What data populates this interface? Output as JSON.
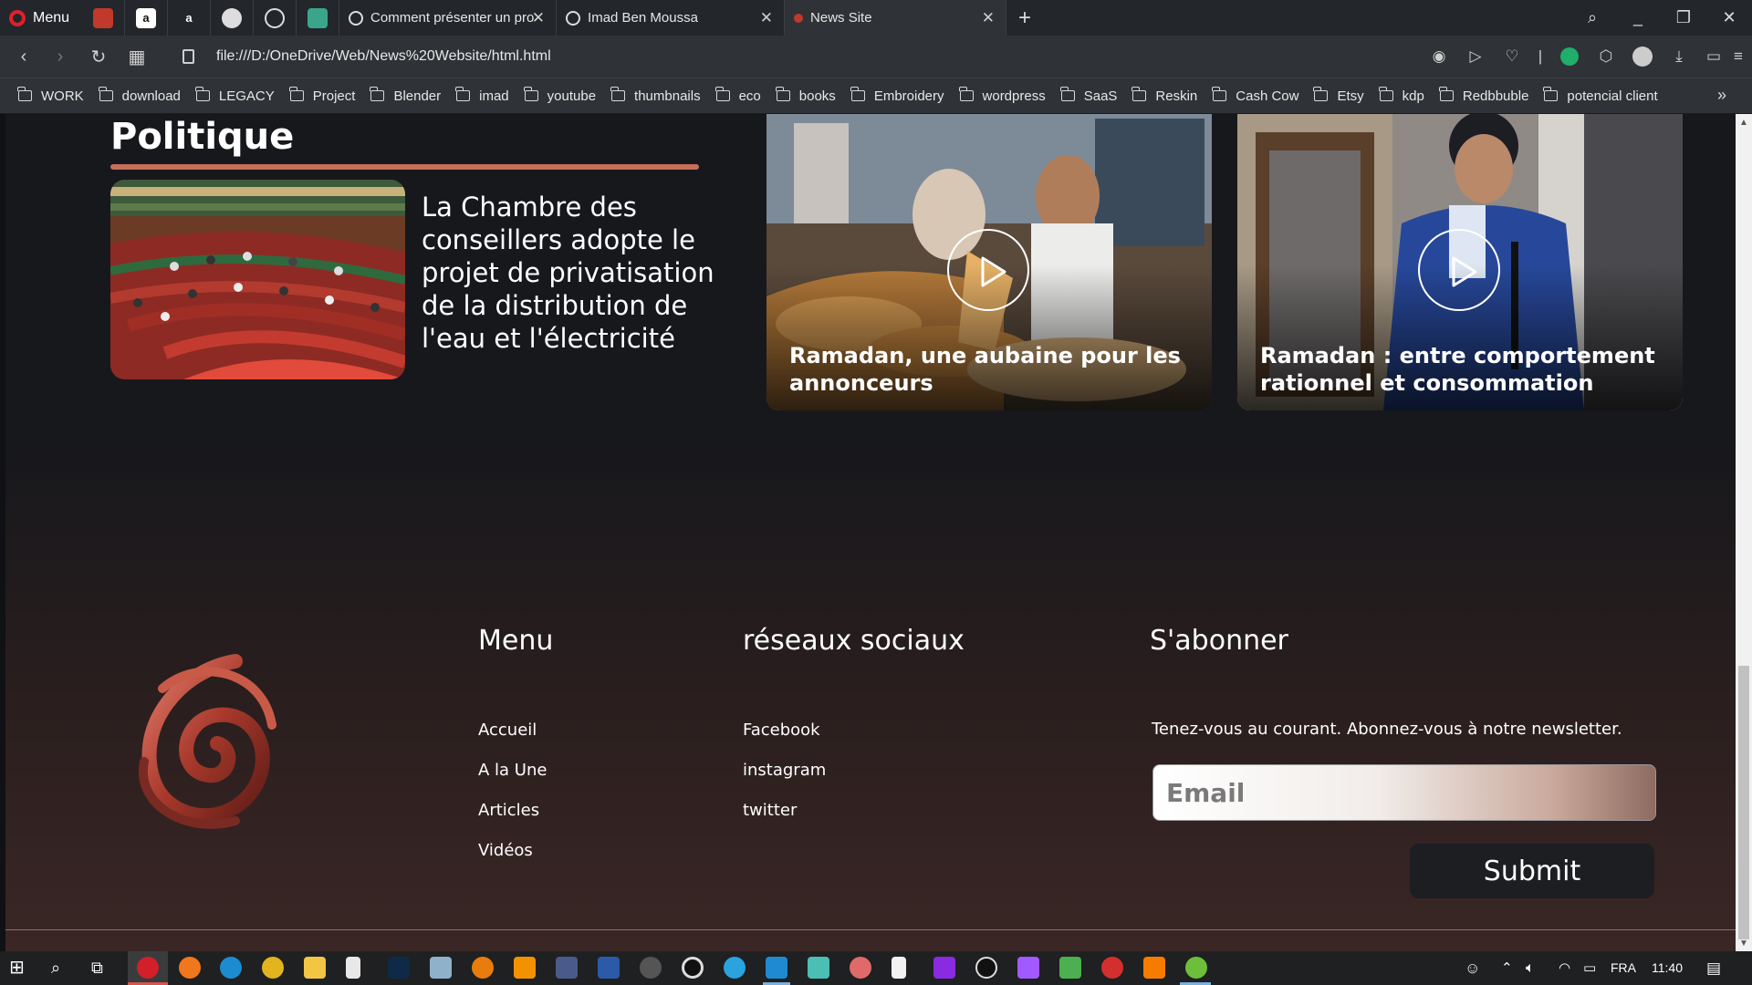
{
  "browser": {
    "menu_label": "Menu",
    "tabs": [
      {
        "title": "Comment présenter un pro",
        "active": false
      },
      {
        "title": "Imad Ben Moussa",
        "active": false
      },
      {
        "title": "News Site",
        "active": true
      }
    ],
    "url": "file:///D:/OneDrive/Web/News%20Website/html.html",
    "bookmarks": [
      "WORK",
      "download",
      "LEGACY",
      "Project",
      "Blender",
      "imad",
      "youtube",
      "thumbnails",
      "eco",
      "books",
      "Embroidery",
      "wordpress",
      "SaaS",
      "Reskin",
      "Cash Cow",
      "Etsy",
      "kdp",
      "Redbbuble",
      "potencial client"
    ]
  },
  "page": {
    "section_title": "Politique",
    "news_headline": "La Chambre des conseillers adopte le projet de privatisation de la distribution de l'eau et l'électricité",
    "videos": [
      {
        "caption": "Ramadan, une aubaine pour les annonceurs"
      },
      {
        "caption": "Ramadan : entre comportement rationnel et consommation"
      }
    ],
    "footer": {
      "menu_title": "Menu",
      "menu_links": [
        "Accueil",
        "A la Une",
        "Articles",
        "Vidéos"
      ],
      "social_title": "réseaux sociaux",
      "social_links": [
        "Facebook",
        "instagram",
        "twitter"
      ],
      "subscribe_title": "S'abonner",
      "subscribe_text": "Tenez-vous au courant. Abonnez-vous à notre newsletter.",
      "email_placeholder": "Email",
      "submit_label": "Submit"
    }
  },
  "taskbar": {
    "language": "FRA",
    "time": "11:40"
  },
  "colors": {
    "accent_line": "#c76e5b",
    "chrome_bg": "#23262b",
    "submit_bg": "#1c1e22"
  }
}
